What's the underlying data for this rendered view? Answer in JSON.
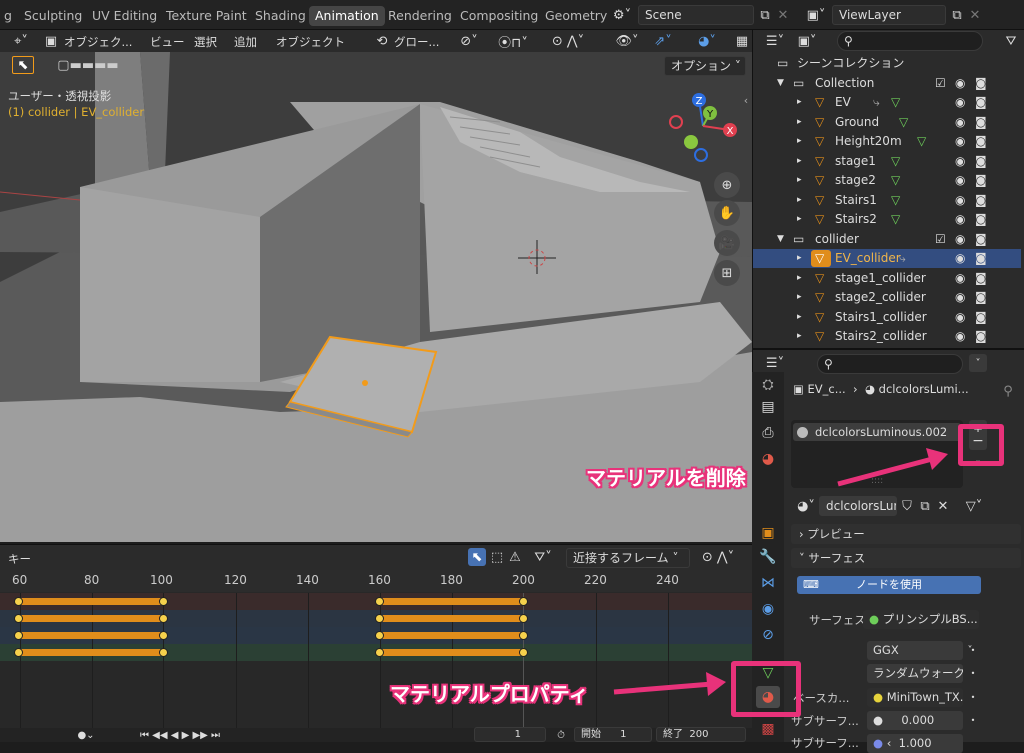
{
  "workspace_tabs": [
    "g",
    "Sculpting",
    "UV Editing",
    "Texture Paint",
    "Shading",
    "Animation",
    "Rendering",
    "Compositing",
    "Geometry"
  ],
  "active_workspace": "Animation",
  "scene": {
    "label": "Scene"
  },
  "view_layer": {
    "label": "ViewLayer"
  },
  "viewport": {
    "menu": [
      "オブジェク...",
      "ビュー",
      "選択",
      "追加",
      "オブジェクト"
    ],
    "transform_orientation": "グロー...",
    "options_label": "オプション",
    "view_name": "ユーザー・透視投影",
    "active_object_info": "(1) collider | EV_collider",
    "gizmo_labels": {
      "z": "Z",
      "y": "Y",
      "x": "X"
    }
  },
  "timeline": {
    "header_label": "キー",
    "interpolation": "近接するフレーム",
    "frame_ticks": [
      "60",
      "80",
      "100",
      "120",
      "140",
      "160",
      "180",
      "200",
      "220",
      "240"
    ],
    "current_frame": "1",
    "start_label": "開始",
    "start_value": "1",
    "end_label": "終了",
    "end_value": "200"
  },
  "outliner": {
    "search_placeholder": "",
    "scene_collection": "シーンコレクション",
    "items": [
      {
        "name": "Collection"
      },
      {
        "name": "EV"
      },
      {
        "name": "Ground"
      },
      {
        "name": "Height20m"
      },
      {
        "name": "stage1"
      },
      {
        "name": "stage2"
      },
      {
        "name": "Stairs1"
      },
      {
        "name": "Stairs2"
      },
      {
        "name": "collider"
      },
      {
        "name": "EV_collider"
      },
      {
        "name": "stage1_collider"
      },
      {
        "name": "stage2_collider"
      },
      {
        "name": "Stairs1_collider"
      },
      {
        "name": "Stairs2_collider"
      }
    ]
  },
  "properties": {
    "breadcrumb_object": "EV_c...",
    "breadcrumb_material": "dclcolorsLumi...",
    "material_slot": "dclcolorsLuminous.002",
    "material_name": "dclcolorsLum...",
    "remove_symbol": "−",
    "preview_label": "プレビュー",
    "surface_label": "サーフェス",
    "use_nodes_label": "ノードを使用",
    "surface_field_label": "サーフェス",
    "surface_field_value": "プリンシプルBS...",
    "distribution": "GGX",
    "subsurface_method": "ランダムウォーク",
    "base_color_label": "ベースカ...",
    "base_color_value": "MiniTown_TX.p...",
    "subsurface_label": "サブサーフ...",
    "subsurface_value": "0.000",
    "subsurface2_label": "サブサーフ...",
    "subsurface2_value": "1.000"
  },
  "annotations": {
    "remove_material": "マテリアルを削除",
    "material_properties": "マテリアルプロパティ"
  },
  "colors": {
    "accent_orange": "#e08d1b",
    "selection_blue": "#334d80",
    "annotation_pink": "#e8327a",
    "use_nodes_blue": "#4772b3"
  }
}
